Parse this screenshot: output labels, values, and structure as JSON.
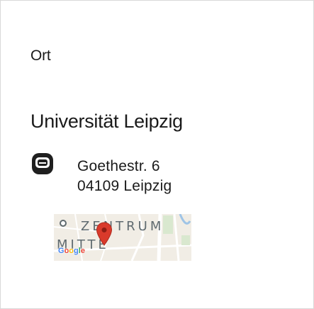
{
  "location": {
    "section_label": "Ort",
    "venue_name": "Universität Leipzig",
    "address": {
      "street": "Goethestr. 6",
      "postal_city": "04109 Leipzig",
      "icon": "location-icon"
    },
    "map": {
      "district_line1": "ZENTRUM",
      "district_line2": "MITTE",
      "provider_logo": "Google",
      "marker_color": "#d93a2b"
    }
  }
}
